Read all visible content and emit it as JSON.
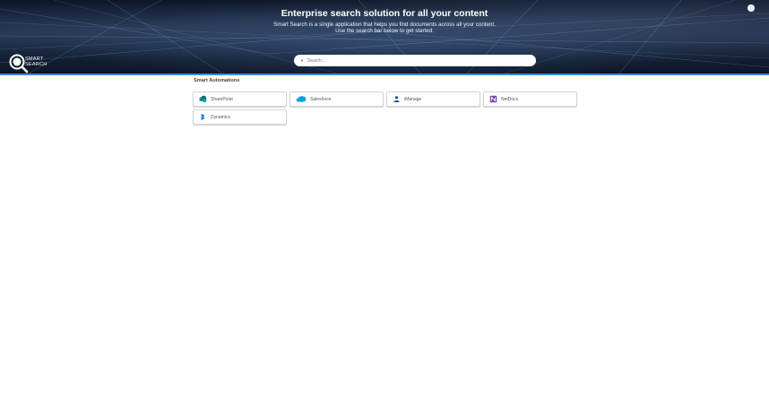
{
  "hero": {
    "title": "Enterprise search solution for all your content",
    "subtitle_line1": "Smart Search is a single application that helps you find documents across all your content.",
    "subtitle_line2": "Use the search bar below to get started."
  },
  "logo": {
    "line1": "SMART",
    "line2": "SEARCH"
  },
  "search": {
    "placeholder": "Search..."
  },
  "section": {
    "title": "Smart Automations"
  },
  "automations": [
    {
      "label": "SharePoint",
      "icon": "sharepoint-icon",
      "color": "#038387"
    },
    {
      "label": "Salesforce",
      "icon": "salesforce-icon",
      "color": "#00a1e0"
    },
    {
      "label": "iManage",
      "icon": "imanage-icon",
      "color": "#1f4e96"
    },
    {
      "label": "NetDocs",
      "icon": "netdocs-icon",
      "color": "#7b3fa0"
    },
    {
      "label": "Dynamics",
      "icon": "dynamics-icon",
      "color": "#0a5bd6"
    }
  ],
  "colors": {
    "accent": "#3a8fd6",
    "hero_bg": "#142238"
  }
}
